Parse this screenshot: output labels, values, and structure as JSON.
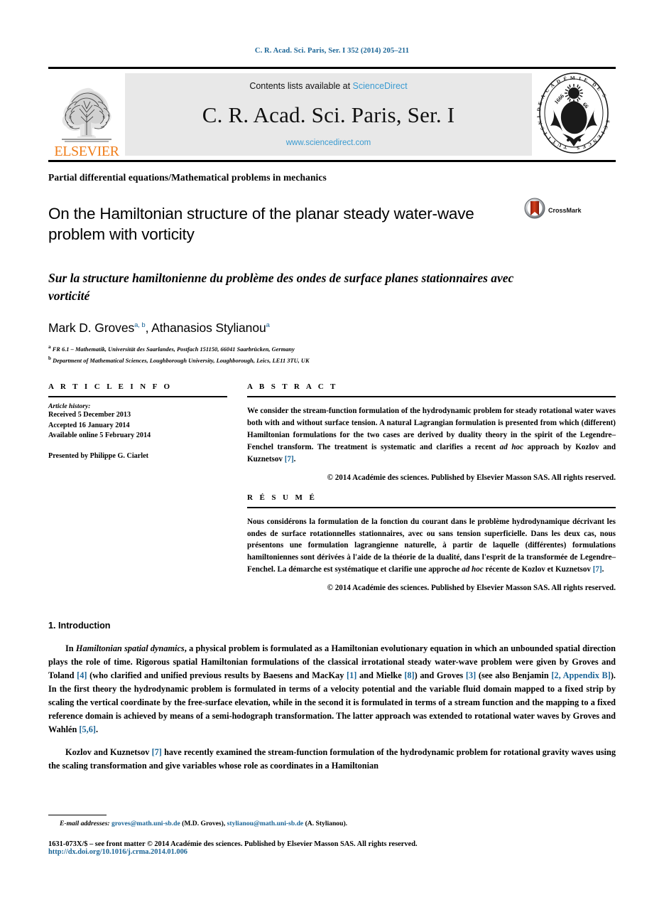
{
  "running_head": "C. R. Acad. Sci. Paris, Ser. I 352 (2014) 205–211",
  "masthead": {
    "publisher": "ELSEVIER",
    "contents_prefix": "Contents lists available at ",
    "contents_link": "ScienceDirect",
    "journal_title": "C. R. Acad. Sci. Paris, Ser. I",
    "journal_url": "www.sciencedirect.com",
    "link_color": "#3a9bd1",
    "box_color": "#e8e8e8",
    "elsevier_color": "#ef7d1a",
    "seal_text": "INSTITUT DE FRANCE ACADÉMIE DES SCIENCES 1666"
  },
  "subject_line": "Partial differential equations/Mathematical problems in mechanics",
  "title_en": "On the Hamiltonian structure of the planar steady water-wave problem with vorticity",
  "title_fr": "Sur la structure hamiltonienne du problème des ondes de surface planes stationnaires avec vorticité",
  "crossmark_label": "CrossMark",
  "authors": [
    {
      "name": "Mark D. Groves",
      "marks": "a, b"
    },
    {
      "name": "Athanasios Stylianou",
      "marks": "a"
    }
  ],
  "affiliations": [
    {
      "mark": "a",
      "text": "FR 6.1 – Mathematik, Universität des Saarlandes, Postfach 151150, 66041 Saarbrücken, Germany"
    },
    {
      "mark": "b",
      "text": "Department of Mathematical Sciences, Loughborough University, Loughborough, Leics, LE11 3TU, UK"
    }
  ],
  "article_info": {
    "heading": "A R T I C L E  I N F O",
    "history_label": "Article history:",
    "history": [
      "Received 5 December 2013",
      "Accepted 16 January 2014",
      "Available online 5 February 2014"
    ],
    "presented_by": "Presented by Philippe G. Ciarlet"
  },
  "abstract": {
    "heading": "A B S T R A C T",
    "text_parts": [
      {
        "t": "We consider the stream-function formulation of the hydrodynamic problem for steady rotational water waves both with and without surface tension. A natural Lagrangian formulation is presented from which (different) Hamiltonian formulations for the two cases are derived by duality theory in the spirit of the Legendre–Fenchel transform. The treatment is systematic and clarifies a recent ",
        "k": "plain"
      },
      {
        "t": "ad hoc",
        "k": "ital"
      },
      {
        "t": " approach by Kozlov and Kuznetsov ",
        "k": "plain"
      },
      {
        "t": "[7]",
        "k": "ref"
      },
      {
        "t": ".",
        "k": "plain"
      }
    ],
    "copyright": "© 2014 Académie des sciences. Published by Elsevier Masson SAS. All rights reserved."
  },
  "resume": {
    "heading": "R É S U M É",
    "text_parts": [
      {
        "t": "Nous considérons la formulation de la fonction du courant dans le problème hydrodynamique décrivant les ondes de surface rotationnelles stationnaires, avec ou sans tension superficielle. Dans les deux cas, nous présentons une formulation lagrangienne naturelle, à partir de laquelle (différentes) formulations hamiltoniennes sont dérivées à l'aide de la théorie de la dualité, dans l'esprit de la transformée de Legendre–Fenchel. La démarche est systématique et clarifie une approche ",
        "k": "plain"
      },
      {
        "t": "ad hoc",
        "k": "ital"
      },
      {
        "t": " récente de Kozlov et Kuznetsov ",
        "k": "plain"
      },
      {
        "t": "[7]",
        "k": "ref"
      },
      {
        "t": ".",
        "k": "plain"
      }
    ],
    "copyright": "© 2014 Académie des sciences. Published by Elsevier Masson SAS. All rights reserved."
  },
  "section": {
    "number_title": "1. Introduction",
    "paragraphs": [
      [
        {
          "t": "In ",
          "k": "plain"
        },
        {
          "t": "Hamiltonian spatial dynamics",
          "k": "ital"
        },
        {
          "t": ", a physical problem is formulated as a Hamiltonian evolutionary equation in which an unbounded spatial direction plays the role of time. Rigorous spatial Hamiltonian formulations of the classical irrotational steady water-wave problem were given by Groves and Toland ",
          "k": "plain"
        },
        {
          "t": "[4]",
          "k": "ref"
        },
        {
          "t": " (who clarified and unified previous results by Baesens and MacKay ",
          "k": "plain"
        },
        {
          "t": "[1]",
          "k": "ref"
        },
        {
          "t": " and Mielke ",
          "k": "plain"
        },
        {
          "t": "[8]",
          "k": "ref"
        },
        {
          "t": ") and Groves ",
          "k": "plain"
        },
        {
          "t": "[3]",
          "k": "ref"
        },
        {
          "t": " (see also Benjamin ",
          "k": "plain"
        },
        {
          "t": "[2, Appendix B]",
          "k": "ref"
        },
        {
          "t": "). In the first theory the hydrodynamic problem is formulated in terms of a velocity potential and the variable fluid domain mapped to a fixed strip by scaling the vertical coordinate by the free-surface elevation, while in the second it is formulated in terms of a stream function and the mapping to a fixed reference domain is achieved by means of a semi-hodograph transformation. The latter approach was extended to rotational water waves by Groves and Wahlén ",
          "k": "plain"
        },
        {
          "t": "[5,6]",
          "k": "ref"
        },
        {
          "t": ".",
          "k": "plain"
        }
      ],
      [
        {
          "t": "Kozlov and Kuznetsov ",
          "k": "plain"
        },
        {
          "t": "[7]",
          "k": "ref"
        },
        {
          "t": " have recently examined the stream-function formulation of the hydrodynamic problem for rotational gravity waves using the scaling transformation and give variables whose role as coordinates in a Hamiltonian",
          "k": "plain"
        }
      ]
    ]
  },
  "footer": {
    "email_label": "E-mail addresses:",
    "emails": [
      {
        "address": "groves@math.uni-sb.de",
        "who": " (M.D. Groves), "
      },
      {
        "address": "stylianou@math.uni-sb.de",
        "who": " (A. Stylianou)."
      }
    ],
    "issn_line": "1631-073X/$ – see front matter © 2014 Académie des sciences. Published by Elsevier Masson SAS. All rights reserved.",
    "doi": "http://dx.doi.org/10.1016/j.crma.2014.01.006"
  }
}
